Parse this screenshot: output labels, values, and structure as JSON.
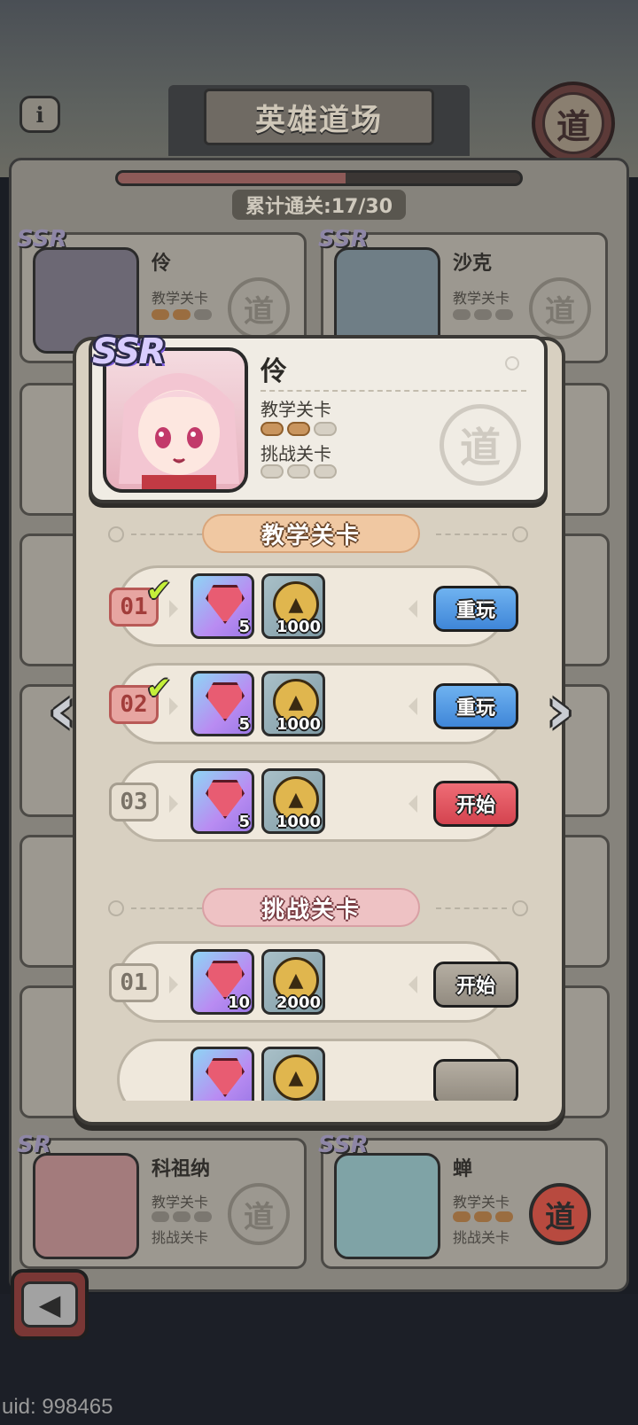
{
  "screen": {
    "title": "英雄道场",
    "info_icon": "info-icon",
    "medal_text": "道",
    "progress": {
      "label": "累计通关:17/30",
      "cleared": 17,
      "total": 30
    }
  },
  "background_heroes": [
    {
      "name": "伶",
      "ssr": "SSR",
      "tutorial_label": "教学关卡",
      "challenge_label": "挑战关卡",
      "tutorial_stars": 2,
      "stamp": "道",
      "stamp_active": false
    },
    {
      "name": "沙克",
      "ssr": "SSR",
      "tutorial_label": "教学关卡",
      "challenge_label": "挑战关卡",
      "tutorial_stars": 0,
      "stamp": "道",
      "stamp_active": false
    },
    {
      "name": "科祖纳",
      "ssr": "SR",
      "tutorial_label": "教学关卡",
      "challenge_label": "挑战关卡",
      "tutorial_stars": 0,
      "stamp": "道",
      "stamp_active": false
    },
    {
      "name": "蝉",
      "ssr": "SSR",
      "tutorial_label": "教学关卡",
      "challenge_label": "挑战关卡",
      "tutorial_stars": 3,
      "stamp": "道",
      "stamp_active": true
    }
  ],
  "hero_detail": {
    "rarity": "SSR",
    "name": "伶",
    "tutorial_label": "教学关卡",
    "challenge_label": "挑战关卡",
    "tutorial_progress": [
      true,
      true,
      false
    ],
    "challenge_progress": [
      false,
      false,
      false
    ],
    "stamp": "道"
  },
  "sections": {
    "tutorial": {
      "title": "教学关卡",
      "levels": [
        {
          "num": "01",
          "cleared": true,
          "gem_qty": "5",
          "coin_qty": "1000",
          "button": "重玩",
          "button_kind": "replay"
        },
        {
          "num": "02",
          "cleared": true,
          "gem_qty": "5",
          "coin_qty": "1000",
          "button": "重玩",
          "button_kind": "replay"
        },
        {
          "num": "03",
          "cleared": false,
          "gem_qty": "5",
          "coin_qty": "1000",
          "button": "开始",
          "button_kind": "start"
        }
      ]
    },
    "challenge": {
      "title": "挑战关卡",
      "levels": [
        {
          "num": "01",
          "cleared": false,
          "gem_qty": "10",
          "coin_qty": "2000",
          "button": "开始",
          "button_kind": "disabled"
        }
      ]
    }
  },
  "footer": {
    "uid": "uid: 998465",
    "back_icon": "back-arrow-icon"
  },
  "colors": {
    "replay_button": "#3f86d8",
    "start_button": "#d4434f",
    "disabled_button": "#928b80",
    "tutorial_pill": "#f0c8a2",
    "challenge_pill": "#eec2c4",
    "check": "#c4ef3a"
  }
}
